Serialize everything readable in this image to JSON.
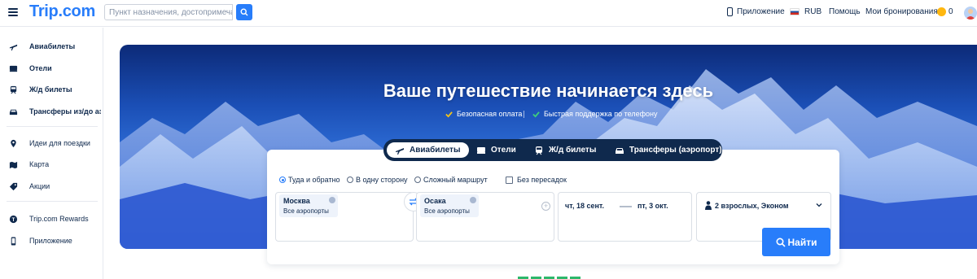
{
  "header": {
    "logo": "Trip.com",
    "search_placeholder": "Пункт назначения, достопримечатель...",
    "app_label": "Приложение",
    "currency": "RUB",
    "help": "Помощь",
    "bookings": "Мои бронирования",
    "coins": "0"
  },
  "sidebar": {
    "items": [
      {
        "label": "Авиабилеты",
        "icon": "plane-icon"
      },
      {
        "label": "Отели",
        "icon": "bed-icon"
      },
      {
        "label": "Ж/д билеты",
        "icon": "train-icon"
      },
      {
        "label": "Трансферы из/до аэ...",
        "icon": "car-icon"
      },
      {
        "label": "Идеи для поездки",
        "icon": "pin-icon"
      },
      {
        "label": "Карта",
        "icon": "map-icon"
      },
      {
        "label": "Акции",
        "icon": "tag-icon"
      },
      {
        "label": "Trip.com Rewards",
        "icon": "rewards-icon"
      },
      {
        "label": "Приложение",
        "icon": "phone-icon"
      }
    ]
  },
  "hero": {
    "title": "Ваше путешествие начинается здесь",
    "features": [
      "Безопасная оплата",
      "Быстрая поддержка по телефону"
    ]
  },
  "tabs": [
    {
      "label": "Авиабилеты",
      "active": true
    },
    {
      "label": "Отели",
      "active": false
    },
    {
      "label": "Ж/д билеты",
      "active": false
    },
    {
      "label": "Трансферы (аэропорт)",
      "active": false
    }
  ],
  "search": {
    "trip_types": [
      "Туда и обратно",
      "В одну сторону",
      "Сложный маршрут"
    ],
    "selected_trip_type": "Туда и обратно",
    "nonstop_label": "Без пересадок",
    "from": {
      "city": "Москва",
      "sub": "Все аэропорты"
    },
    "to": {
      "city": "Осака",
      "sub": "Все аэропорты"
    },
    "depart_date": "чт, 18 сент.",
    "return_date": "пт, 3 окт.",
    "passengers": "2 взрослых, Эконом",
    "search_button": "Найти"
  },
  "colors": {
    "brand": "#287dfa",
    "navy": "#0f294d"
  }
}
